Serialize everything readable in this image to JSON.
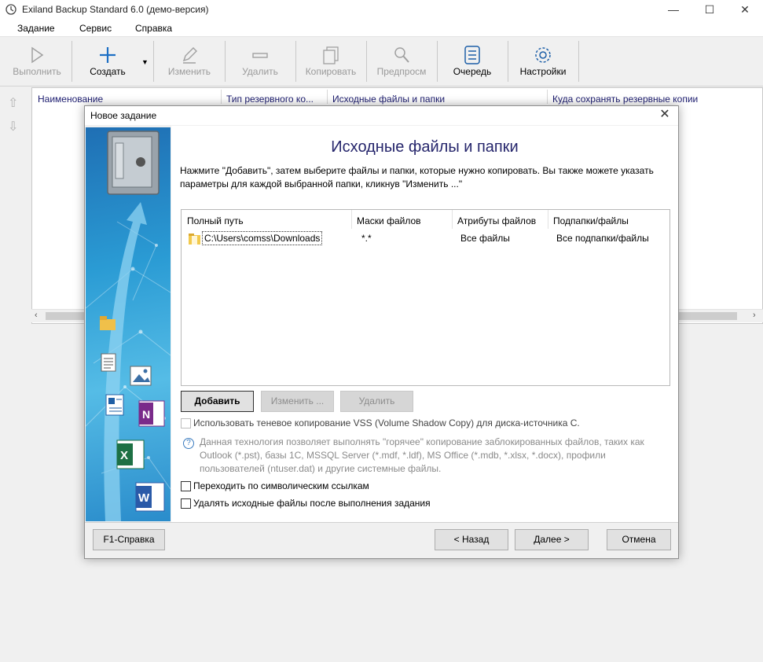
{
  "window": {
    "title": "Exiland Backup Standard 6.0 (демо-версия)",
    "minimize": "—",
    "maximize": "☐",
    "close": "✕"
  },
  "menu": [
    "Задание",
    "Сервис",
    "Справка"
  ],
  "toolbar": {
    "run": "Выполнить",
    "create": "Создать",
    "edit": "Изменить",
    "delete": "Удалить",
    "copy": "Копировать",
    "preview": "Предпросм",
    "queue": "Очередь",
    "settings": "Настройки"
  },
  "grid": {
    "columns": [
      "Наименование",
      "Тип резервного ко...",
      "Исходные файлы и папки",
      "Куда сохранять резервные копии"
    ]
  },
  "dialog": {
    "title": "Новое задание",
    "heading": "Исходные файлы и папки",
    "description": "Нажмите \"Добавить\", затем выберите файлы и папки, которые нужно копировать. Вы также можете указать параметры для каждой выбранной папки, кликнув \"Изменить ...\"",
    "columns": [
      "Полный путь",
      "Маски файлов",
      "Атрибуты файлов",
      "Подпапки/файлы"
    ],
    "rows": [
      {
        "path": "C:\\Users\\comss\\Downloads",
        "masks": "*.*",
        "attributes": "Все файлы",
        "subfolders": "Все подпапки/файлы"
      }
    ],
    "buttons": {
      "add": "Добавить",
      "edit": "Изменить ...",
      "delete": "Удалить"
    },
    "vss_label": "Использовать теневое копирование VSS (Volume Shadow Copy) для диска-источника C.",
    "vss_help": "Данная технология позволяет выполнять \"горячее\" копирование заблокированных файлов, таких как Outlook (*.pst), базы 1С, MSSQL Server (*.mdf, *.ldf), MS Office (*.mdb, *.xlsx, *.docx), профили пользователей (ntuser.dat) и другие системные файлы.",
    "follow_symlinks": "Переходить по символическим ссылкам",
    "delete_sources": "Удалять исходные файлы после выполнения задания",
    "footer": {
      "help": "F1-Справка",
      "back": "< Назад",
      "next": "Далее >",
      "cancel": "Отмена"
    }
  },
  "colors": {
    "heading": "#25256b",
    "sidebar_top": "#1f6fb4",
    "sidebar_mid": "#55bce6"
  }
}
